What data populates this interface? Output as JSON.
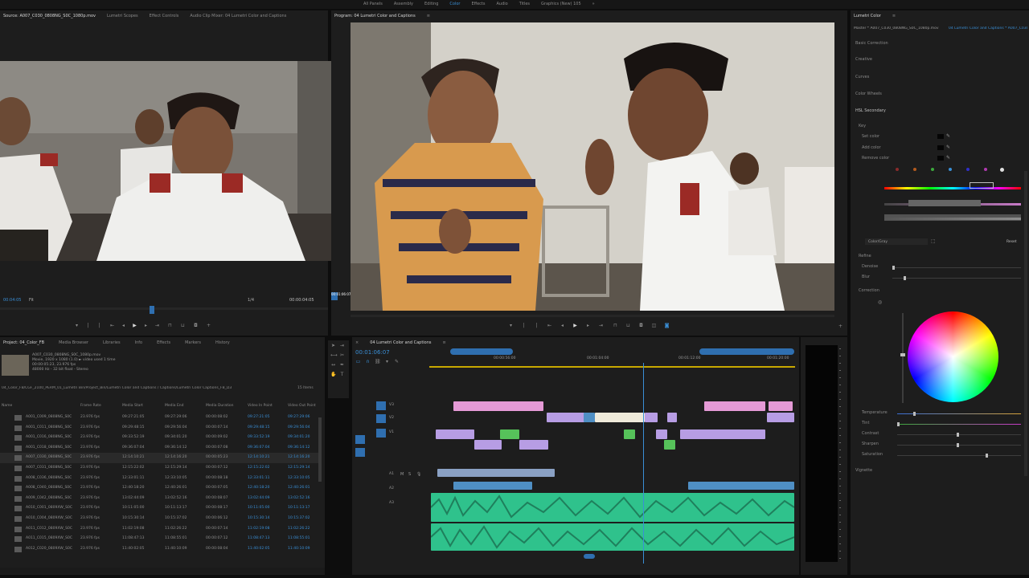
{
  "workspace": {
    "tabs": [
      "All Panels",
      "Assembly",
      "Editing",
      "Color",
      "Effects",
      "Audio",
      "Titles",
      "Graphics (New) 105"
    ],
    "active_index": 3
  },
  "source_monitor": {
    "tabs": [
      "Source: A007_C030_0808NG_S0C_1080p.mov",
      "Lumetri Scopes",
      "Effect Controls",
      "Audio Clip Mixer: 04 Lumetri Color and Captions"
    ],
    "timecode_in": "00:04:05",
    "fit_label": "Fit",
    "scale": "1/4",
    "timecode_out": "00:00:04:05"
  },
  "program_monitor": {
    "tab": "Program: 04 Lumetri Color and Captions",
    "timecode": "00:01:06:07"
  },
  "project_panel": {
    "tabs": [
      "Project: 04_Color_FB",
      "Media Browser",
      "Libraries",
      "Info",
      "Effects",
      "Markers",
      "History"
    ],
    "preview_lines": [
      "A007_C030_0808NG_S0C_1080p.mov",
      "Movie, 1920 x 1080 (1.0) ► video used 1 time",
      "00:00:05:23, 23.976 fps",
      "48000 Hz - 32 bit float - Stereo"
    ],
    "path_line": "04_Color_FB/CGF_2100_PERM_01_Lumetri Bin/Project_Bin/Lumetri Color and Captions / Captions/Lumetri Color Captions_FB_D3",
    "item_count": "15 Items",
    "headers": [
      "Name",
      "Frame Rate",
      "Media Start",
      "Media End",
      "Media Duration",
      "Video In Point",
      "Video Out Point"
    ],
    "rows": [
      [
        "A001_C009_0808NG_S0C",
        "23.976 fps",
        "09:27:21:05",
        "09:27:29:06",
        "00:00:08:02",
        "09:27:21:05",
        "09:27:29:06"
      ],
      [
        "A001_C011_0808NG_S0C",
        "23.976 fps",
        "09:29:48:15",
        "09:29:56:04",
        "00:00:07:14",
        "09:29:48:15",
        "09:29:56:04"
      ],
      [
        "A001_C016_0808NG_S0C",
        "23.976 fps",
        "09:33:52:19",
        "09:34:01:20",
        "00:00:09:02",
        "09:33:52:19",
        "09:34:01:20"
      ],
      [
        "A001_C018_0808NG_S0C",
        "23.976 fps",
        "09:36:07:04",
        "09:36:14:12",
        "00:00:07:08",
        "09:36:07:04",
        "09:36:14:12"
      ],
      [
        "A007_C030_0808NG_S0C",
        "23.976 fps",
        "12:14:10:21",
        "12:14:16:20",
        "00:00:05:23",
        "12:14:10:21",
        "12:14:16:20"
      ],
      [
        "A007_C031_0808NG_S0C",
        "23.976 fps",
        "12:15:22:02",
        "12:15:29:14",
        "00:00:07:12",
        "12:15:22:02",
        "12:15:29:14"
      ],
      [
        "A008_C036_0808NG_S0C",
        "23.976 fps",
        "12:33:01:11",
        "12:33:10:05",
        "00:00:08:18",
        "12:33:01:11",
        "12:33:10:05"
      ],
      [
        "A008_C040_0808NG_S0C",
        "23.976 fps",
        "12:40:18:20",
        "12:40:26:01",
        "00:00:07:05",
        "12:40:18:20",
        "12:40:26:01"
      ],
      [
        "A009_C042_0808NG_S0C",
        "23.976 fps",
        "13:02:44:09",
        "13:02:52:16",
        "00:00:08:07",
        "13:02:44:09",
        "13:02:52:16"
      ],
      [
        "A010_C001_0809XW_S0C",
        "23.976 fps",
        "10:11:05:00",
        "10:11:13:17",
        "00:00:08:17",
        "10:11:05:00",
        "10:11:13:17"
      ],
      [
        "A010_C004_0809XW_S0C",
        "23.976 fps",
        "10:15:30:14",
        "10:15:37:02",
        "00:00:06:12",
        "10:15:30:14",
        "10:15:37:02"
      ],
      [
        "A011_C012_0809XW_S0C",
        "23.976 fps",
        "11:02:19:08",
        "11:02:26:22",
        "00:00:07:14",
        "11:02:19:08",
        "11:02:26:22"
      ],
      [
        "A011_C015_0809XW_S0C",
        "23.976 fps",
        "11:08:47:13",
        "11:08:55:01",
        "00:00:07:12",
        "11:08:47:13",
        "11:08:55:01"
      ],
      [
        "A012_C020_0809XW_S0C",
        "23.976 fps",
        "11:40:02:05",
        "11:40:10:09",
        "00:00:08:04",
        "11:40:02:05",
        "11:40:10:09"
      ]
    ]
  },
  "timeline": {
    "tab": "04 Lumetri Color and Captions",
    "timecode": "00:01:06:07",
    "ruler": [
      "00:00:56:00",
      "00:01:04:00",
      "00:01:12:00",
      "00:01:20:00"
    ],
    "tracks": [
      "V3",
      "V2",
      "V1",
      "A1",
      "A2",
      "A3"
    ]
  },
  "lumetri": {
    "tab": "Lumetri Color",
    "master": "Master * A007_C030_0808NG_S0C_1080p.mov",
    "clip": "04 Lumetri Color and Captions * A007_C030_0808NG_S0C_1080p",
    "sections": [
      "Basic Correction",
      "Creative",
      "Curves",
      "Color Wheels",
      "HSL Secondary"
    ],
    "key": "Key",
    "key_rows": [
      "Set color",
      "Add color",
      "Remove color"
    ],
    "color_gray": "Color/Gray",
    "reset": "Reset",
    "refine": "Refine",
    "refine_rows": [
      "Denoise",
      "Blur"
    ],
    "correction": "Correction",
    "wheel_rows": [
      "Temperature",
      "Tint",
      "Contrast",
      "Sharpen",
      "Saturation"
    ],
    "vignette": "Vignette"
  }
}
